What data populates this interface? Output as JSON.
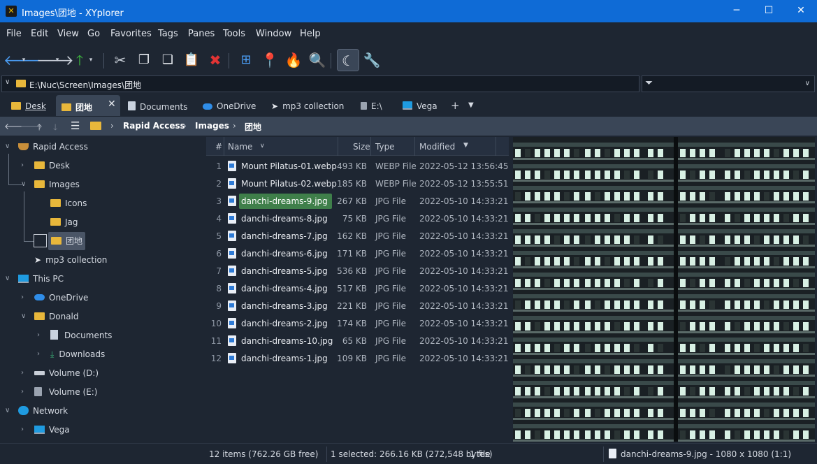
{
  "window": {
    "title": "Images\\团地 - XYplorer",
    "app_icon": "xyplorer-logo-icon",
    "minimize": "─",
    "maximize": "☐",
    "close": "✕"
  },
  "menu": [
    "File",
    "Edit",
    "View",
    "Go",
    "Favorites",
    "Tags",
    "Panes",
    "Tools",
    "Window",
    "Help"
  ],
  "address": {
    "path": "E:\\Nuc\\Screen\\Images\\团地"
  },
  "filter": {
    "value": ""
  },
  "tabs": [
    {
      "label": "Desk"
    },
    {
      "label": "团地",
      "active": true
    },
    {
      "label": "Documents"
    },
    {
      "label": "OneDrive"
    },
    {
      "label": "mp3 collection"
    },
    {
      "label": "E:\\"
    },
    {
      "label": "Vega"
    }
  ],
  "tab_add": "+",
  "breadcrumb": {
    "items": [
      "Rapid Access",
      "Images",
      "团地"
    ]
  },
  "tree": {
    "rapid_access": "Rapid Access",
    "desk": "Desk",
    "images": "Images",
    "icons": "Icons",
    "jag": "Jag",
    "danchi": "团地",
    "mp3": "mp3 collection",
    "this_pc": "This PC",
    "onedrive": "OneDrive",
    "donald": "Donald",
    "documents": "Documents",
    "downloads": "Downloads",
    "vol_d": "Volume (D:)",
    "vol_e": "Volume (E:)",
    "network": "Network",
    "vega": "Vega"
  },
  "list": {
    "headers": {
      "num": "#",
      "name": "Name",
      "size": "Size",
      "type": "Type",
      "modified": "Modified"
    },
    "rows": [
      {
        "n": "1",
        "name": "Mount Pilatus-01.webp",
        "size": "493 KB",
        "type": "WEBP File",
        "modified": "2022-05-12 13:56:45"
      },
      {
        "n": "2",
        "name": "Mount Pilatus-02.webp",
        "size": "185 KB",
        "type": "WEBP File",
        "modified": "2022-05-12 13:55:51"
      },
      {
        "n": "3",
        "name": "danchi-dreams-9.jpg",
        "size": "267 KB",
        "type": "JPG File",
        "modified": "2022-05-10 14:33:21",
        "selected": true
      },
      {
        "n": "4",
        "name": "danchi-dreams-8.jpg",
        "size": "75 KB",
        "type": "JPG File",
        "modified": "2022-05-10 14:33:21"
      },
      {
        "n": "5",
        "name": "danchi-dreams-7.jpg",
        "size": "162 KB",
        "type": "JPG File",
        "modified": "2022-05-10 14:33:21"
      },
      {
        "n": "6",
        "name": "danchi-dreams-6.jpg",
        "size": "171 KB",
        "type": "JPG File",
        "modified": "2022-05-10 14:33:21"
      },
      {
        "n": "7",
        "name": "danchi-dreams-5.jpg",
        "size": "536 KB",
        "type": "JPG File",
        "modified": "2022-05-10 14:33:21"
      },
      {
        "n": "8",
        "name": "danchi-dreams-4.jpg",
        "size": "517 KB",
        "type": "JPG File",
        "modified": "2022-05-10 14:33:21"
      },
      {
        "n": "9",
        "name": "danchi-dreams-3.jpg",
        "size": "221 KB",
        "type": "JPG File",
        "modified": "2022-05-10 14:33:21"
      },
      {
        "n": "10",
        "name": "danchi-dreams-2.jpg",
        "size": "174 KB",
        "type": "JPG File",
        "modified": "2022-05-10 14:33:21"
      },
      {
        "n": "11",
        "name": "danchi-dreams-10.jpg",
        "size": "65 KB",
        "type": "JPG File",
        "modified": "2022-05-10 14:33:21"
      },
      {
        "n": "12",
        "name": "danchi-dreams-1.jpg",
        "size": "109 KB",
        "type": "JPG File",
        "modified": "2022-05-10 14:33:21"
      }
    ]
  },
  "status": {
    "items": "12 items (762.26 GB free)",
    "selection": "1 selected: 266.16 KB (272,548 bytes)",
    "files": "1 file",
    "preview": "danchi-dreams-9.jpg - 1080 x 1080 (1:1)"
  },
  "colors": {
    "titlebar": "#0f6bd6",
    "background": "#1e2632",
    "folder": "#e8b73b",
    "selection": "#3f7f4a"
  }
}
